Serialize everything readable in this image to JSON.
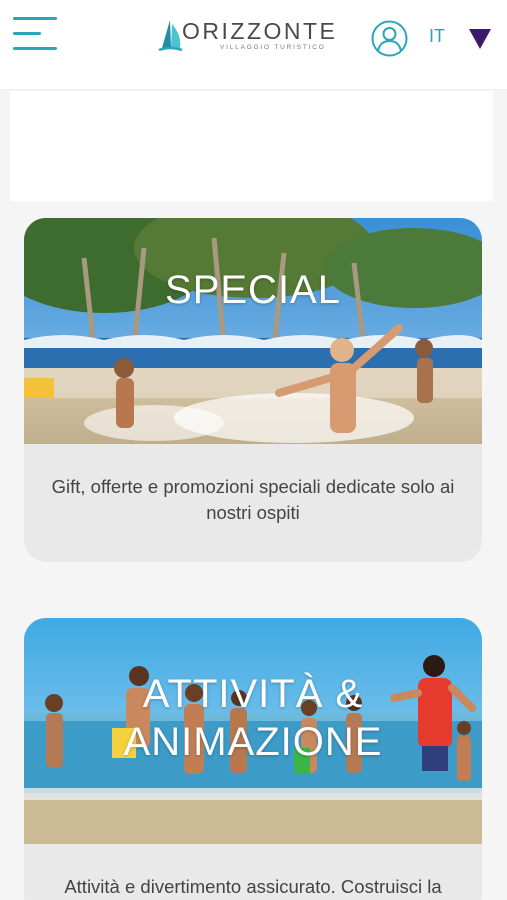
{
  "header": {
    "logo_name": "ORIZZONTE",
    "logo_sub": "VILLAGGIO TURISTICO",
    "language": "IT"
  },
  "cards": [
    {
      "title": "SPECIAL",
      "description": "Gift, offerte e promozioni speciali dedicate solo ai nostri ospiti"
    },
    {
      "title": "ATTIVITÀ & ANIMAZIONE",
      "description": "Attività e divertimento assicurato. Costruisci la"
    }
  ],
  "colors": {
    "accent": "#2aa7b7",
    "arrow": "#3b1a6b",
    "card_bg": "#e9e9e9",
    "page_bg": "#f5f5f5"
  },
  "icons": {
    "menu": "hamburger-menu-icon",
    "user": "user-icon",
    "language_arrow": "triangle-down-icon"
  }
}
